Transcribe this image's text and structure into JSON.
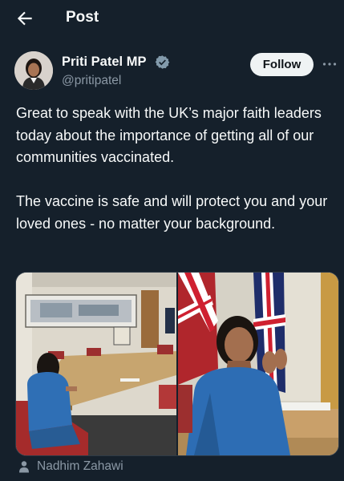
{
  "header": {
    "title": "Post"
  },
  "tweet": {
    "author_name": "Priti Patel MP",
    "author_handle": "@pritipatel",
    "follow_label": "Follow",
    "paragraphs": [
      "Great to speak with the UK’s major faith leaders today about the importance of getting all of our communities vaccinated.",
      "The vaccine is safe and will protect you and your loved ones - no matter your background."
    ],
    "media_tag": "Nadhim Zahawi"
  },
  "colors": {
    "background": "#15202b",
    "text_primary": "#f7f9f9",
    "text_secondary": "#8b98a5",
    "verified_badge": "#829aab",
    "follow_button_bg": "#eff3f4"
  },
  "icons": {
    "back": "arrow-left-icon",
    "verified": "verified-badge-icon",
    "more": "more-horizontal-icon",
    "tag": "person-icon"
  }
}
